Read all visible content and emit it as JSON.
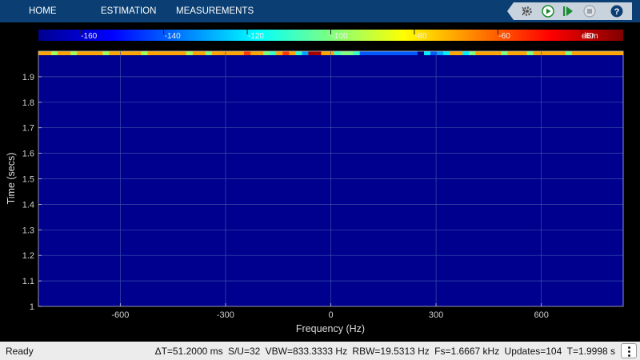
{
  "toolbar": {
    "tabs": [
      {
        "label": "HOME"
      },
      {
        "label": "ESTIMATION"
      },
      {
        "label": "MEASUREMENTS"
      }
    ],
    "help_label": "?"
  },
  "colorbar": {
    "ticks": [
      "-160",
      "-140",
      "-120",
      "-100",
      "-80",
      "-60",
      "-40"
    ],
    "unit": "dBm",
    "range": [
      -170,
      -30
    ]
  },
  "chart_data": {
    "type": "heatmap",
    "xlabel": "Frequency (Hz)",
    "ylabel": "Time (secs)",
    "xlim": [
      -833.3333,
      833.3333
    ],
    "ylim": [
      1.0,
      2.0
    ],
    "x_ticks": [
      -600,
      -300,
      0,
      300,
      600
    ],
    "x_tick_labels": [
      "-600",
      "-300",
      "0",
      "300",
      "600"
    ],
    "y_ticks": [
      1.0,
      1.1,
      1.2,
      1.3,
      1.4,
      1.5,
      1.6,
      1.7,
      1.8,
      1.9
    ],
    "y_tick_labels": [
      "1",
      "1.1",
      "1.2",
      "1.3",
      "1.4",
      "1.5",
      "1.6",
      "1.7",
      "1.8",
      "1.9"
    ],
    "grid": true,
    "background_level_dbm": -170,
    "top_row_levels_dbm": [
      -70,
      -70,
      -95,
      -70,
      -70,
      -95,
      -70,
      -70,
      -70,
      -70,
      -95,
      -70,
      -70,
      -70,
      -70,
      -70,
      -95,
      -70,
      -70,
      -70,
      -70,
      -70,
      -70,
      -95,
      -70,
      -70,
      -100,
      -70,
      -70,
      -70,
      -70,
      -70,
      -55,
      -70,
      -70,
      -100,
      -110,
      -70,
      -55,
      -70,
      -110,
      -130,
      -35,
      -35,
      -70,
      -70,
      -110,
      -100,
      -100,
      -110,
      -140,
      -140,
      -140,
      -140,
      -140,
      -140,
      -140,
      -140,
      -140,
      -170,
      -120,
      -140,
      -130,
      -120,
      -70,
      -70,
      -120,
      -100,
      -70,
      -70,
      -70,
      -70,
      -100,
      -70,
      -70,
      -70,
      -100,
      -70,
      -70,
      -70,
      -70,
      -70,
      -100,
      -70,
      -70,
      -70,
      -70,
      -70,
      -70,
      -70,
      -70
    ]
  },
  "status": {
    "state": "Ready",
    "dt": "ΔT=51.2000 ms",
    "su": "S/U=32",
    "vbw": "VBW=833.3333 Hz",
    "rbw": "RBW=19.5313 Hz",
    "fs": "Fs=1.6667 kHz",
    "updates": "Updates=104",
    "t": "T=1.9998 s"
  },
  "colors": {
    "toolbar_bg": "#0b3f73",
    "plot_bg": "#00008f",
    "grid": "#3a4fa8",
    "axis_text": "#d0d0d0"
  }
}
